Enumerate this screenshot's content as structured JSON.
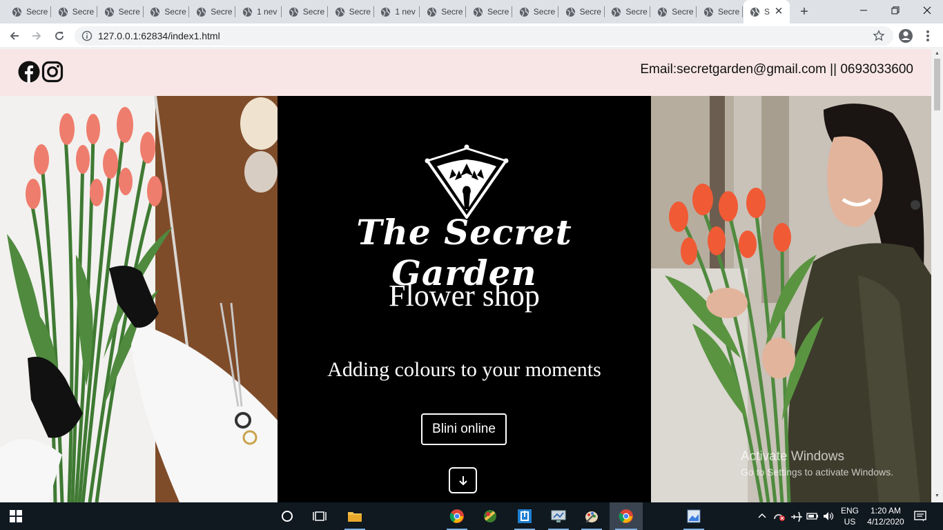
{
  "browser": {
    "tabs": [
      {
        "title": "Secre"
      },
      {
        "title": "Secre"
      },
      {
        "title": "Secre"
      },
      {
        "title": "Secre"
      },
      {
        "title": "Secre"
      },
      {
        "title": "1 nev"
      },
      {
        "title": "Secre"
      },
      {
        "title": "Secre"
      },
      {
        "title": "1 nev"
      },
      {
        "title": "Secre"
      },
      {
        "title": "Secre"
      },
      {
        "title": "Secre"
      },
      {
        "title": "Secre"
      },
      {
        "title": "Secre"
      },
      {
        "title": "Secre"
      },
      {
        "title": "Secre"
      }
    ],
    "active_tab_title": "S",
    "url": "127.0.0.1:62834/index1.html"
  },
  "site": {
    "contact": "Email:secretgarden@gmail.com || 0693033600",
    "social": [
      "facebook-icon",
      "instagram-icon"
    ],
    "brand": "The Secret Garden",
    "subtitle": "Flower shop",
    "tagline": "Adding colours to your moments",
    "cta_label": "Blini online",
    "colors": {
      "topbar_bg": "#f8e6e6",
      "hero_center_bg": "#000000",
      "text_light": "#ffffff"
    }
  },
  "watermark": {
    "line1": "Activate Windows",
    "line2": "Go to Settings to activate Windows."
  },
  "taskbar": {
    "language": "ENG",
    "region": "US",
    "time": "1:20 AM",
    "date": "4/12/2020"
  }
}
